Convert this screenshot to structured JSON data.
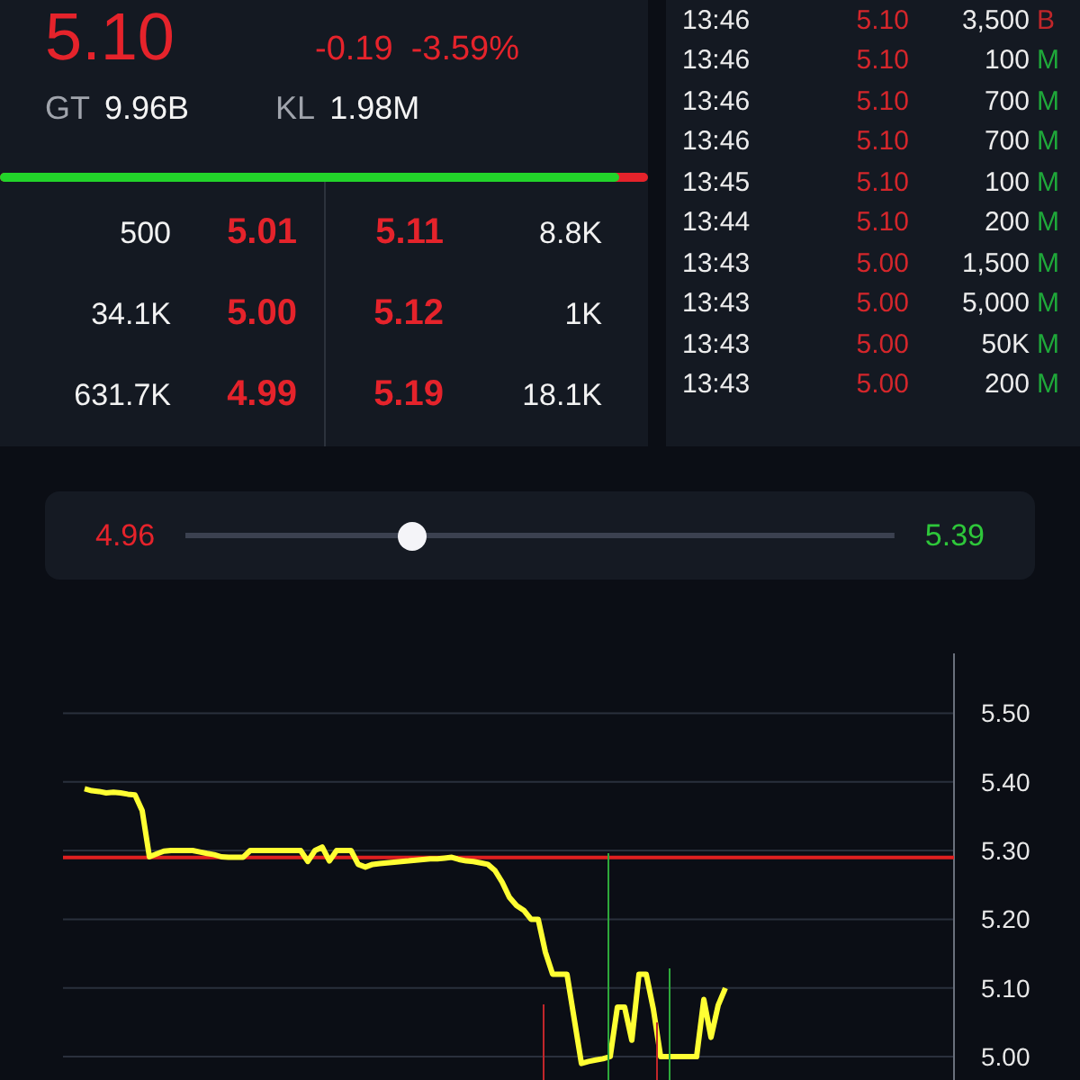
{
  "quote": {
    "price": "5.10",
    "change": "-0.19",
    "change_pct": "-3.59%",
    "stats": [
      {
        "label": "GT",
        "value": "9.96B"
      },
      {
        "label": "KL",
        "value": "1.98M"
      }
    ],
    "buy_ratio": {
      "level": 0.955
    }
  },
  "order_book": {
    "bids": [
      {
        "volume": "500",
        "price": "5.01"
      },
      {
        "volume": "34.1K",
        "price": "5.00"
      },
      {
        "volume": "631.7K",
        "price": "4.99"
      }
    ],
    "asks": [
      {
        "price": "5.11",
        "volume": "8.8K"
      },
      {
        "price": "5.12",
        "volume": "1K"
      },
      {
        "price": "5.19",
        "volume": "18.1K"
      }
    ]
  },
  "trades": [
    {
      "time": "13:46",
      "price": "5.10",
      "volume": "3,500",
      "side": "B",
      "color": "#c0262a"
    },
    {
      "time": "13:46",
      "price": "5.10",
      "volume": "100",
      "side": "M",
      "color": "#1fa83a"
    },
    {
      "time": "13:46",
      "price": "5.10",
      "volume": "700",
      "side": "M",
      "color": "#1fa83a"
    },
    {
      "time": "13:46",
      "price": "5.10",
      "volume": "700",
      "side": "M",
      "color": "#1fa83a"
    },
    {
      "time": "13:45",
      "price": "5.10",
      "volume": "100",
      "side": "M",
      "color": "#1fa83a"
    },
    {
      "time": "13:44",
      "price": "5.10",
      "volume": "200",
      "side": "M",
      "color": "#1fa83a"
    },
    {
      "time": "13:43",
      "price": "5.00",
      "volume": "1,500",
      "side": "M",
      "color": "#1fa83a"
    },
    {
      "time": "13:43",
      "price": "5.00",
      "volume": "5,000",
      "side": "M",
      "color": "#1fa83a"
    },
    {
      "time": "13:43",
      "price": "5.00",
      "volume": "50K",
      "side": "M",
      "color": "#1fa83a"
    },
    {
      "time": "13:43",
      "price": "5.00",
      "volume": "200",
      "side": "M",
      "color": "#1fa83a"
    }
  ],
  "range": {
    "low": "4.96",
    "high": "5.39",
    "level": 0.32
  },
  "chart": {
    "chart_data": {
      "type": "line",
      "ylim": [
        4.966,
        5.587
      ],
      "grid": true,
      "yticks": [
        {
          "value": 5.0,
          "label": "5.00"
        },
        {
          "value": 5.1,
          "label": "5.10"
        },
        {
          "value": 5.2,
          "label": "5.20"
        },
        {
          "value": 5.3,
          "label": "5.30"
        },
        {
          "value": 5.4,
          "label": "5.40"
        },
        {
          "value": 5.5,
          "label": "5.50"
        }
      ],
      "categories": [
        null,
        null,
        null,
        null,
        null,
        null,
        null,
        null,
        null,
        null,
        null,
        null,
        null,
        null,
        null,
        null,
        null,
        null,
        null,
        null,
        null,
        null,
        null,
        null,
        null,
        null,
        null,
        null,
        null,
        null,
        null,
        null,
        null,
        null,
        null,
        null,
        null,
        null,
        null,
        null,
        null,
        null,
        null,
        null,
        null,
        null,
        null,
        null,
        null,
        null,
        null,
        null,
        null,
        null,
        null,
        null,
        null,
        null,
        null,
        null,
        null,
        null,
        null,
        null,
        null,
        null,
        null,
        null,
        null,
        null,
        null,
        null,
        null,
        null,
        null,
        null,
        null,
        null,
        null,
        null,
        null,
        null,
        null,
        null,
        null,
        null,
        null,
        null,
        null,
        null
      ],
      "series": [
        {
          "color": "#ffff33",
          "values": [
            5.39,
            5.387,
            5.386,
            5.384,
            5.385,
            5.384,
            5.382,
            5.381,
            5.358,
            5.291,
            5.295,
            5.299,
            5.3,
            5.3,
            5.3,
            5.3,
            5.298,
            5.296,
            5.294,
            5.291,
            5.29,
            5.29,
            5.29,
            5.3,
            5.3,
            5.3,
            5.3,
            5.3,
            5.3,
            5.3,
            5.3,
            5.284,
            5.3,
            5.305,
            5.285,
            5.3,
            5.3,
            5.3,
            5.28,
            5.276,
            5.28,
            5.281,
            5.282,
            5.283,
            5.284,
            5.285,
            5.286,
            5.287,
            5.288,
            5.288,
            5.289,
            5.29,
            5.287,
            5.285,
            5.284,
            5.282,
            5.28,
            5.271,
            5.254,
            5.232,
            5.22,
            5.213,
            5.2,
            5.2,
            5.152,
            5.12,
            5.12,
            5.12,
            5.055,
            4.99,
            4.993,
            4.995,
            4.997,
            5.0,
            5.072,
            5.072,
            5.024,
            5.12,
            5.12,
            5.069,
            5.0,
            5.0,
            5.0,
            5.0,
            5.0,
            5.0,
            5.083,
            5.028,
            5.075,
            5.1
          ]
        }
      ],
      "ref_lines": [
        {
          "axis": "y",
          "value": 5.29,
          "color": "#e02020"
        }
      ]
    }
  }
}
